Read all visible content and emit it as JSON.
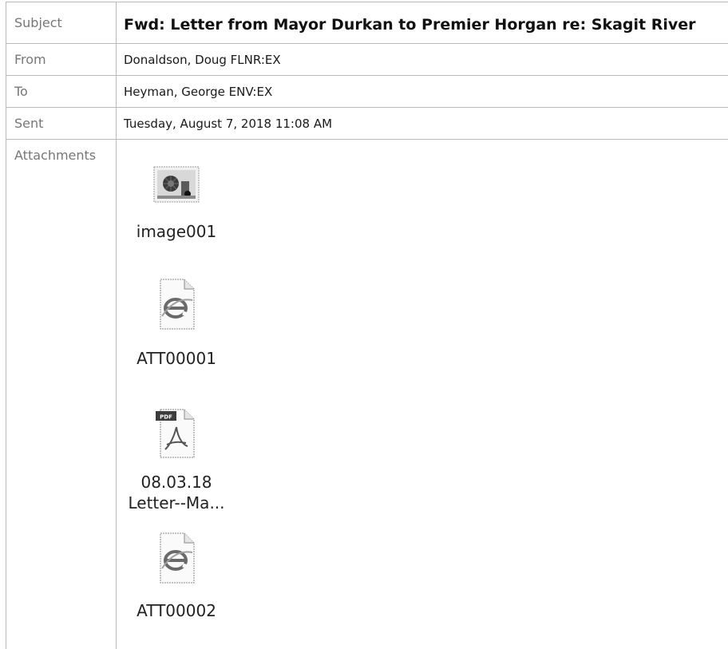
{
  "header": {
    "subject_label": "Subject",
    "subject_value": "Fwd: Letter from Mayor Durkan to Premier Horgan re: Skagit River",
    "from_label": "From",
    "from_value": "Donaldson, Doug FLNR:EX",
    "to_label": "To",
    "to_value": "Heyman, George ENV:EX",
    "sent_label": "Sent",
    "sent_value": "Tuesday, August 7, 2018 11:08 AM",
    "attachments_label": "Attachments"
  },
  "attachments": [
    {
      "name": "image001",
      "icon": "image-file-icon"
    },
    {
      "name": "ATT00001",
      "icon": "html-file-icon"
    },
    {
      "name_line1": "08.03.18",
      "name_line2": "Letter--Ma...",
      "icon": "pdf-file-icon"
    },
    {
      "name": "ATT00002",
      "icon": "html-file-icon"
    }
  ]
}
